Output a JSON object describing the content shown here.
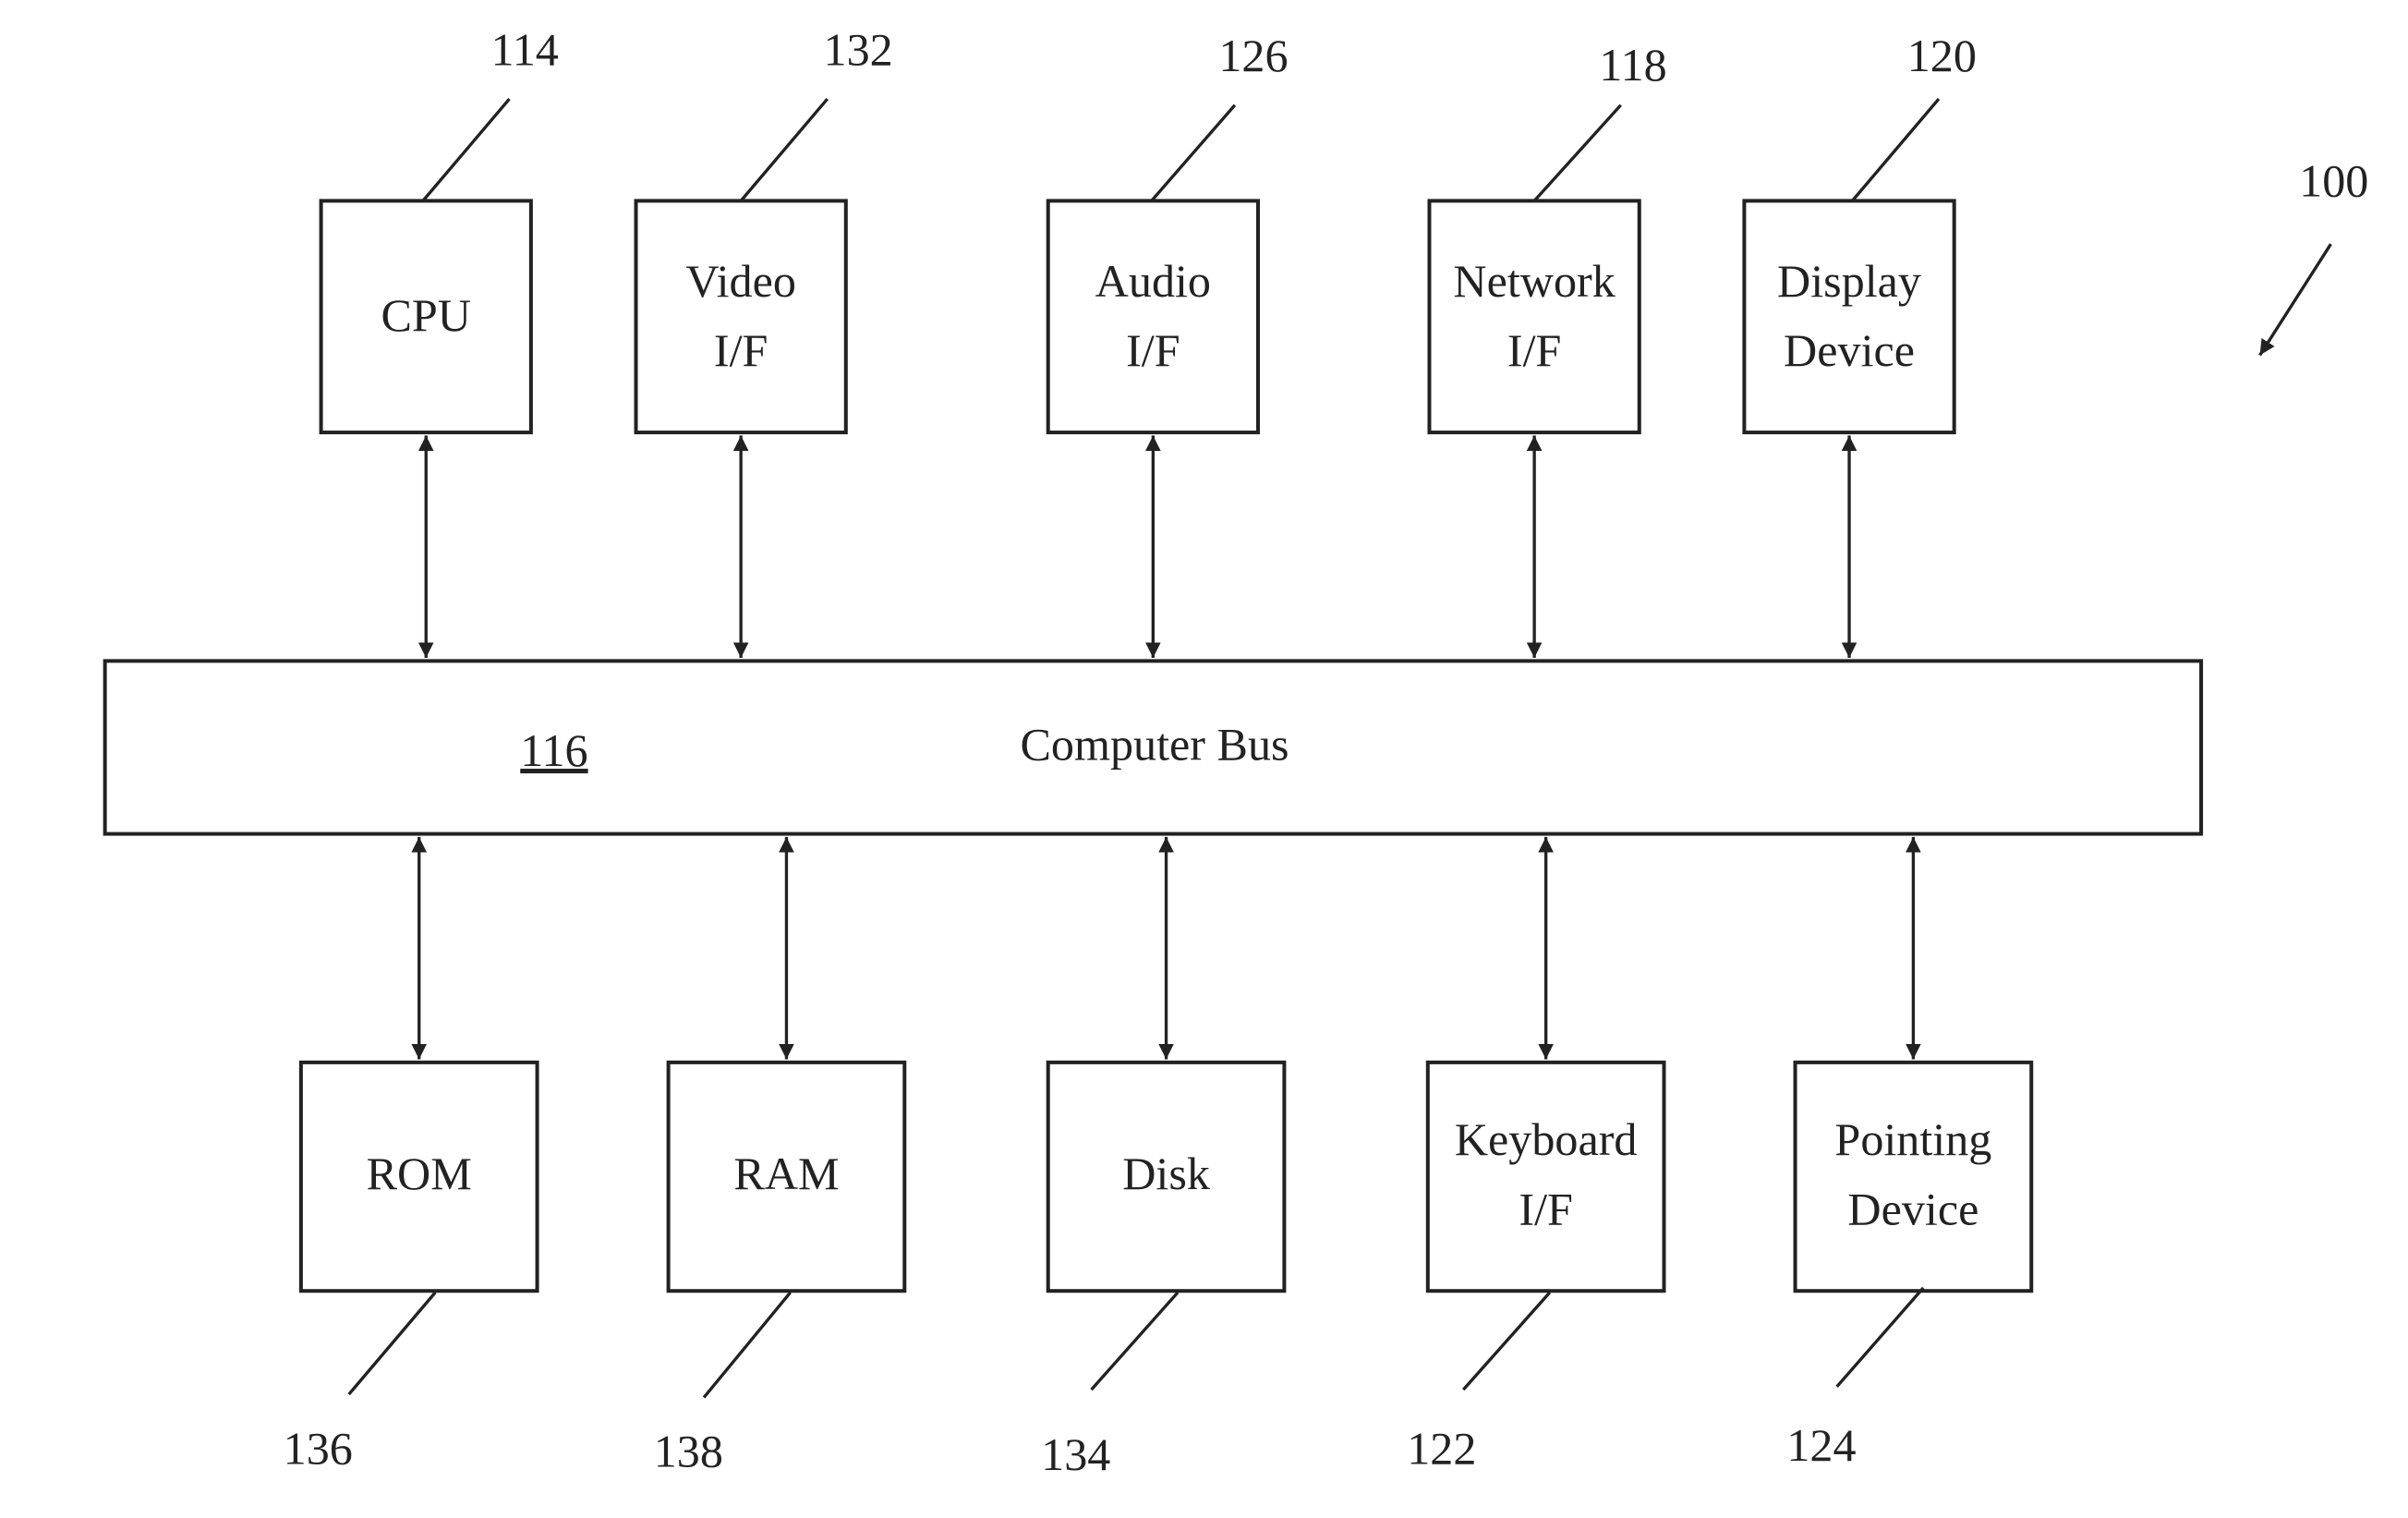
{
  "figure": {
    "ref": "100",
    "bus": {
      "label": "Computer Bus",
      "ref": "116"
    },
    "top_components": [
      {
        "ref": "114",
        "lines": [
          "CPU"
        ]
      },
      {
        "ref": "132",
        "lines": [
          "Video",
          "I/F"
        ]
      },
      {
        "ref": "126",
        "lines": [
          "Audio",
          "I/F"
        ]
      },
      {
        "ref": "118",
        "lines": [
          "Network",
          "I/F"
        ]
      },
      {
        "ref": "120",
        "lines": [
          "Display",
          "Device"
        ]
      }
    ],
    "bottom_components": [
      {
        "ref": "136",
        "lines": [
          "ROM"
        ]
      },
      {
        "ref": "138",
        "lines": [
          "RAM"
        ]
      },
      {
        "ref": "134",
        "lines": [
          "Disk"
        ]
      },
      {
        "ref": "122",
        "lines": [
          "Keyboard",
          "I/F"
        ]
      },
      {
        "ref": "124",
        "lines": [
          "Pointing",
          "Device"
        ]
      }
    ]
  }
}
